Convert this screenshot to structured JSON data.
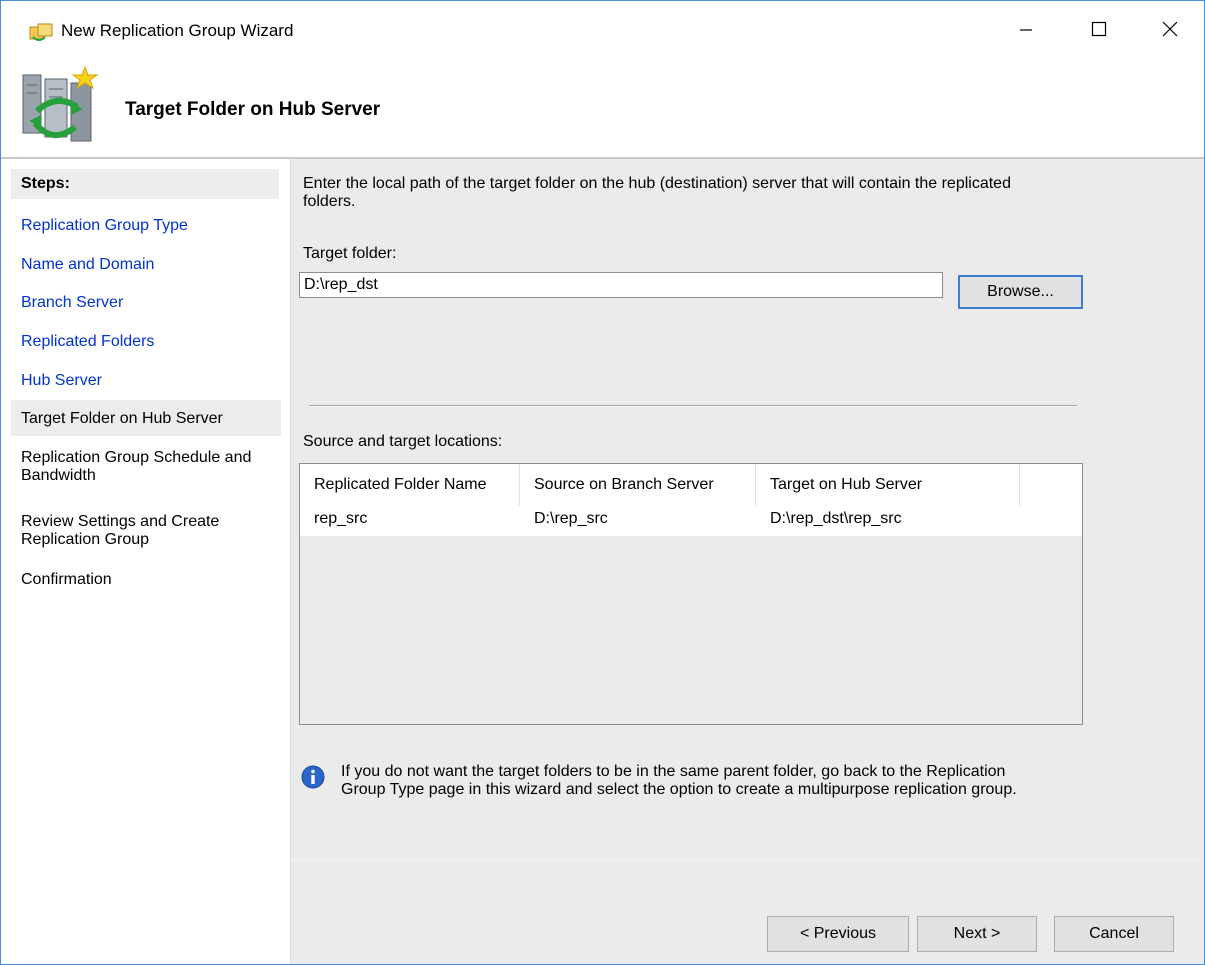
{
  "window": {
    "title": "New Replication Group Wizard",
    "controls": {
      "minimize": "minimize-icon",
      "maximize": "maximize-icon",
      "close": "close-icon"
    }
  },
  "header": {
    "title": "Target Folder on Hub Server",
    "icon": "replication-server-icon"
  },
  "sidebar": {
    "heading": "Steps:",
    "steps": [
      {
        "label": "Replication Group Type",
        "state": "link"
      },
      {
        "label": "Name and Domain",
        "state": "link"
      },
      {
        "label": "Branch Server",
        "state": "link"
      },
      {
        "label": "Replicated Folders",
        "state": "link"
      },
      {
        "label": "Hub Server",
        "state": "link"
      },
      {
        "label": "Target Folder on Hub Server",
        "state": "current"
      },
      {
        "label": "Replication Group Schedule and Bandwidth",
        "state": "pending"
      },
      {
        "label": "Review Settings and Create Replication Group",
        "state": "pending"
      },
      {
        "label": "Confirmation",
        "state": "pending"
      }
    ]
  },
  "main": {
    "description": "Enter the local path of the target folder on the hub (destination) server that will contain the replicated folders.",
    "target_folder_label": "Target folder:",
    "target_folder_value": "D:\\rep_dst",
    "browse_label": "Browse...",
    "locations_label": "Source and target locations:",
    "table": {
      "columns": [
        "Replicated Folder Name",
        "Source on Branch Server",
        "Target on Hub Server"
      ],
      "rows": [
        [
          "rep_src",
          "D:\\rep_src",
          "D:\\rep_dst\\rep_src"
        ]
      ]
    },
    "info_icon": "info-icon",
    "info_text": "If you do not want the target folders to be in the same parent folder, go back to the Replication Group Type page in this wizard and select the option to create a multipurpose replication group."
  },
  "footer": {
    "previous_label": "< Previous",
    "next_label": "Next >",
    "cancel_label": "Cancel"
  },
  "colors": {
    "link": "#0033cc",
    "content_bg": "#ebebeb",
    "window_border": "#4a8fd8",
    "focus_border": "#3c7fd1"
  }
}
